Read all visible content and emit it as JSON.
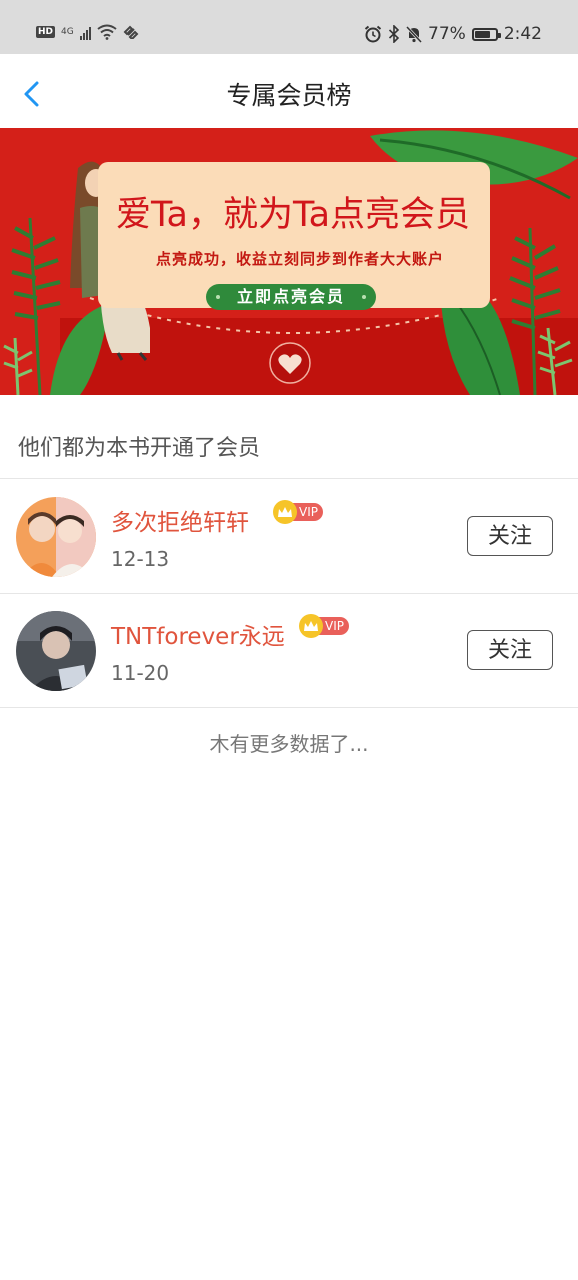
{
  "status_bar": {
    "hd_label": "HD",
    "signal_label": "4G",
    "battery_text": "77%",
    "battery_level": 0.77,
    "time": "2:42",
    "icons": [
      "wifi-icon",
      "alarm-icon",
      "bluetooth-icon",
      "mute-bell-icon",
      "battery-icon"
    ]
  },
  "header": {
    "title": "专属会员榜",
    "back_icon": "chevron-left-icon"
  },
  "banner": {
    "title": "爱Ta，就为Ta点亮会员",
    "subtitle": "点亮成功，收益立刻同步到作者大大账户",
    "button_label": "立即点亮会员",
    "colors": {
      "background": "#d42019",
      "card": "#fbdcb8",
      "button": "#2f8a3b",
      "title": "#d1161b"
    }
  },
  "section": {
    "title": "他们都为本书开通了会员"
  },
  "members": [
    {
      "name": "多次拒绝轩轩",
      "badge": "VIP",
      "date": "12-13",
      "follow_label": "关注"
    },
    {
      "name": "TNTforever永远",
      "badge": "VIP",
      "date": "11-20",
      "follow_label": "关注"
    }
  ],
  "footer": {
    "no_more_text": "木有更多数据了..."
  },
  "colors": {
    "accent": "#2196f3",
    "name": "#e0543d",
    "vip_tag": "#e9605a",
    "crown": "#f6c428"
  }
}
